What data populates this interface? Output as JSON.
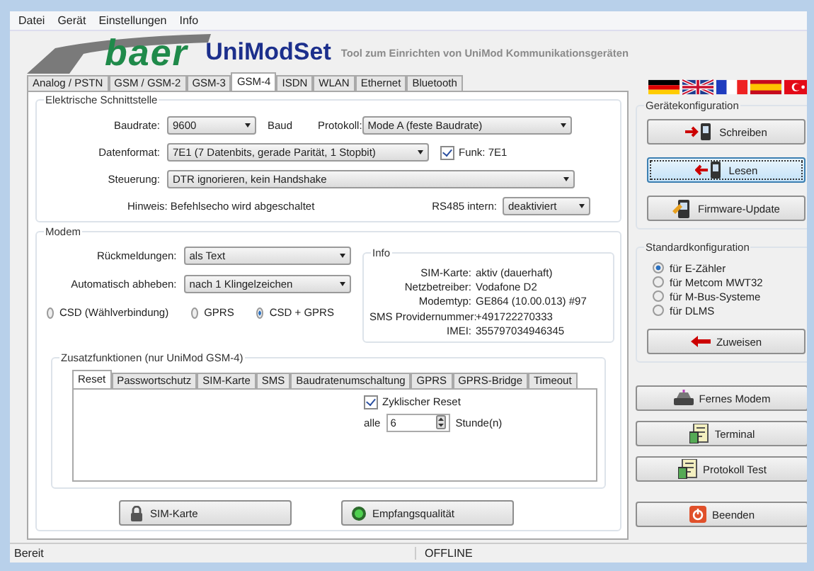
{
  "menu": [
    {
      "label": "Datei"
    },
    {
      "label": "Gerät"
    },
    {
      "label": "Einstellungen"
    },
    {
      "label": "Info"
    }
  ],
  "header": {
    "brand": "baer",
    "app_name": "UniModSet",
    "subtitle": "Tool zum Einrichten von UniMod Kommunikationsgeräten"
  },
  "tabs": [
    {
      "label": "Analog / PSTN",
      "selected": false
    },
    {
      "label": "GSM / GSM-2",
      "selected": false
    },
    {
      "label": "GSM-3",
      "selected": false
    },
    {
      "label": "GSM-4",
      "selected": true
    },
    {
      "label": "ISDN",
      "selected": false
    },
    {
      "label": "WLAN",
      "selected": false
    },
    {
      "label": "Ethernet",
      "selected": false
    },
    {
      "label": "Bluetooth",
      "selected": false
    }
  ],
  "interface": {
    "title": "Elektrische Schnittstelle",
    "baudrate": {
      "label": "Baudrate:",
      "value": "9600",
      "unit": "Baud"
    },
    "protocol": {
      "label": "Protokoll:",
      "value": "Mode A (feste Baudrate)"
    },
    "data_format": {
      "label": "Datenformat:",
      "value": "7E1 (7 Datenbits, gerade Parität, 1 Stopbit)"
    },
    "funk": {
      "label": "Funk: 7E1",
      "checked": true
    },
    "control": {
      "label": "Steuerung:",
      "value": "DTR ignorieren, kein Handshake"
    },
    "hint": "Hinweis: Befehlsecho wird abgeschaltet",
    "rs485": {
      "label": "RS485 intern:",
      "value": "deaktiviert"
    }
  },
  "modem": {
    "title": "Modem",
    "responses": {
      "label": "Rückmeldungen:",
      "value": "als Text"
    },
    "auto_answer": {
      "label": "Automatisch abheben:",
      "value": "nach 1 Klingelzeichen"
    },
    "modes": [
      {
        "label": "CSD (Wählverbindung)",
        "selected": false
      },
      {
        "label": "GPRS",
        "selected": false
      },
      {
        "label": "CSD + GPRS",
        "selected": true
      }
    ],
    "info": {
      "title": "Info",
      "rows": [
        {
          "label": "SIM-Karte:",
          "value": "aktiv (dauerhaft)"
        },
        {
          "label": "Netzbetreiber:",
          "value": "Vodafone D2"
        },
        {
          "label": "Modemtyp:",
          "value": "GE864 (10.00.013) #97"
        },
        {
          "label": "SMS Providernummer:",
          "value": "+491722270333"
        },
        {
          "label": "IMEI:",
          "value": "355797034946345"
        }
      ]
    },
    "extras": {
      "title": "Zusatzfunktionen (nur UniMod GSM-4)",
      "tabs": [
        {
          "label": "Reset",
          "selected": true
        },
        {
          "label": "Passwortschutz",
          "selected": false
        },
        {
          "label": "SIM-Karte",
          "selected": false
        },
        {
          "label": "SMS",
          "selected": false
        },
        {
          "label": "Baudratenumschaltung",
          "selected": false
        },
        {
          "label": "GPRS",
          "selected": false
        },
        {
          "label": "GPRS-Bridge",
          "selected": false
        },
        {
          "label": "Timeout",
          "selected": false
        }
      ],
      "reset": {
        "label": "Zyklischer Reset",
        "checked": true
      },
      "interval": {
        "label": "alle",
        "value": "6",
        "unit": "Stunde(n)"
      }
    },
    "buttons": [
      {
        "label": "SIM-Karte",
        "kind": "lock"
      },
      {
        "label": "Empfangsqualität",
        "kind": "signal"
      }
    ]
  },
  "device_config": {
    "title": "Gerätekonfiguration",
    "buttons": [
      {
        "label": "Schreiben",
        "kind": "write",
        "focused": false
      },
      {
        "label": "Lesen",
        "kind": "read",
        "focused": true
      },
      {
        "label": "Firmware-Update",
        "kind": "firmware",
        "focused": false
      }
    ]
  },
  "standard_config": {
    "title": "Standardkonfiguration",
    "options": [
      {
        "label": "für E-Zähler",
        "selected": true
      },
      {
        "label": "für Metcom MWT32",
        "selected": false
      },
      {
        "label": "für M-Bus-Systeme",
        "selected": false
      },
      {
        "label": "für DLMS",
        "selected": false
      }
    ],
    "button": {
      "label": "Zuweisen",
      "kind": "assign"
    }
  },
  "side_buttons": [
    {
      "label": "Fernes Modem",
      "kind": "modem"
    },
    {
      "label": "Terminal",
      "kind": "terminal"
    },
    {
      "label": "Protokoll Test",
      "kind": "terminal"
    }
  ],
  "exit_button": {
    "label": "Beenden",
    "kind": "exit"
  },
  "status_bar": [
    "Bereit",
    "OFFLINE"
  ]
}
